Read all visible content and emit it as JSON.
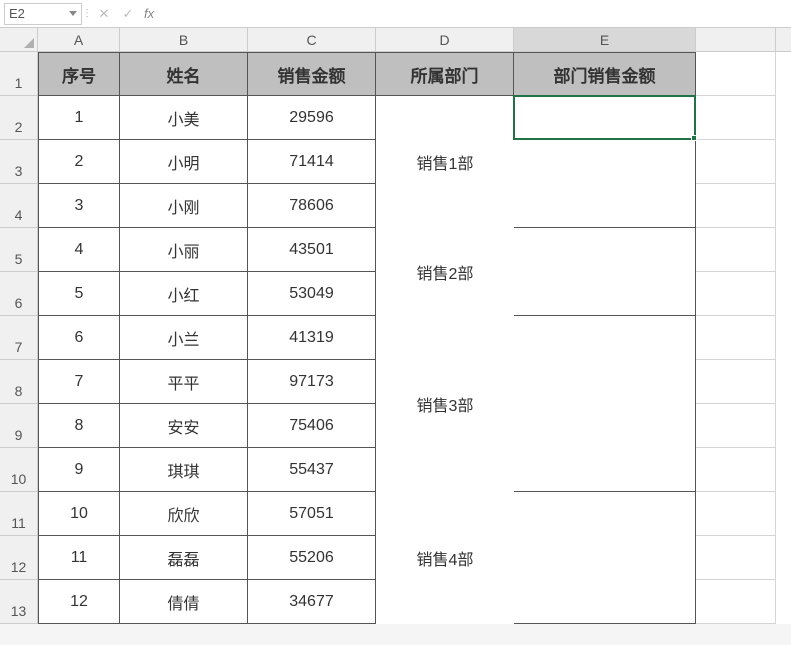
{
  "formula_bar": {
    "cell_ref": "E2",
    "cancel": "✕",
    "confirm": "✓",
    "fx": "fx",
    "value": ""
  },
  "columns": [
    "A",
    "B",
    "C",
    "D",
    "E"
  ],
  "row_numbers": [
    "1",
    "2",
    "3",
    "4",
    "5",
    "6",
    "7",
    "8",
    "9",
    "10",
    "11",
    "12",
    "13"
  ],
  "headers": {
    "a": "序号",
    "b": "姓名",
    "c": "销售金额",
    "d": "所属部门",
    "e": "部门销售金额"
  },
  "table": [
    {
      "seq": "1",
      "name": "小美",
      "amount": "29596"
    },
    {
      "seq": "2",
      "name": "小明",
      "amount": "71414"
    },
    {
      "seq": "3",
      "name": "小刚",
      "amount": "78606"
    },
    {
      "seq": "4",
      "name": "小丽",
      "amount": "43501"
    },
    {
      "seq": "5",
      "name": "小红",
      "amount": "53049"
    },
    {
      "seq": "6",
      "name": "小兰",
      "amount": "41319"
    },
    {
      "seq": "7",
      "name": "平平",
      "amount": "97173"
    },
    {
      "seq": "8",
      "name": "安安",
      "amount": "75406"
    },
    {
      "seq": "9",
      "name": "琪琪",
      "amount": "55437"
    },
    {
      "seq": "10",
      "name": "欣欣",
      "amount": "57051"
    },
    {
      "seq": "11",
      "name": "磊磊",
      "amount": "55206"
    },
    {
      "seq": "12",
      "name": "倩倩",
      "amount": "34677"
    }
  ],
  "departments": {
    "d1": "销售1部",
    "d2": "销售2部",
    "d3": "销售3部",
    "d4": "销售4部"
  },
  "selected_cell": "E2"
}
